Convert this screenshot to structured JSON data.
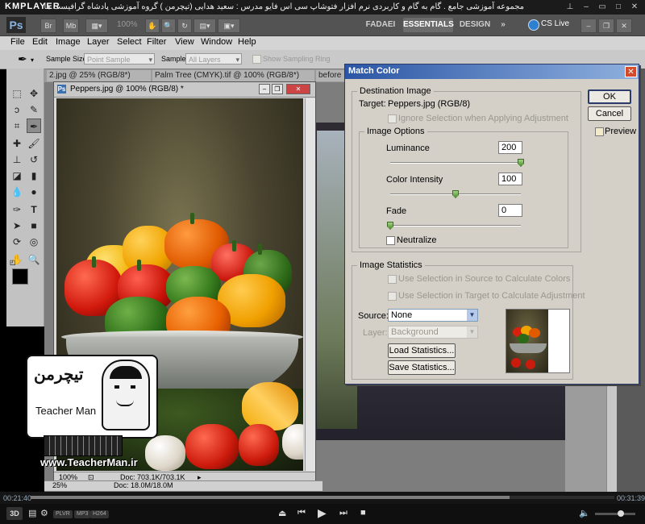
{
  "player": {
    "logo": "KMPLAYER",
    "title": "مجموعه آموزشی جامع . گام به گام و کاربردی نرم افزار فتوشاپ سی اس فایو  مدرس : سعید هدایی (تیچرمن ) گروه آموزشی پادشاه گرافیست ها",
    "time_elapsed": "00:21:40",
    "time_total": "00:31:39",
    "progress": 0.82,
    "badges": [
      "PLVR",
      "MP3",
      "H264"
    ],
    "mode_label": "3D"
  },
  "photoshop": {
    "logo": "Ps",
    "zoom": "100%",
    "workspaces": [
      "FADAEI",
      "ESSENTIALS",
      "DESIGN"
    ],
    "active_workspace": "ESSENTIALS",
    "cs_live": "CS Live",
    "menu": [
      "File",
      "Edit",
      "Image",
      "Layer",
      "Select",
      "Filter",
      "View",
      "Window",
      "Help"
    ],
    "options": {
      "sample_size_label": "Sample Size:",
      "sample_size_value": "Point Sample",
      "sample_label": "Sample:",
      "sample_value": "All Layers",
      "show_ring": "Show Sampling Ring"
    },
    "tabs": [
      "2.jpg @ 25% (RGB/8*)",
      "Palm Tree (CMYK).tif @ 100% (RGB/8*)",
      "before"
    ],
    "document": {
      "title": "Peppers.jpg @ 100% (RGB/8) *",
      "zoom": "100%",
      "doc_size": "Doc: 703.1K/703.1K"
    },
    "document2": {
      "zoom": "25%",
      "doc_size": "Doc: 18.0M/18.0M"
    }
  },
  "dialog": {
    "title": "Match Color",
    "ok": "OK",
    "cancel": "Cancel",
    "preview": "Preview",
    "destination_label": "Destination Image",
    "target_label": "Target:",
    "target_value": "Peppers.jpg (RGB/8)",
    "ignore_selection": "Ignore Selection when Applying Adjustment",
    "image_options_label": "Image Options",
    "luminance_label": "Luminance",
    "luminance_value": "200",
    "luminance_fraction": 1.0,
    "intensity_label": "Color Intensity",
    "intensity_value": "100",
    "intensity_fraction": 0.5,
    "fade_label": "Fade",
    "fade_value": "0",
    "fade_fraction": 0.0,
    "neutralize": "Neutralize",
    "stats_label": "Image Statistics",
    "use_sel_source": "Use Selection in Source to Calculate Colors",
    "use_sel_target": "Use Selection in Target to Calculate Adjustment",
    "source_label": "Source:",
    "source_value": "None",
    "layer_label": "Layer:",
    "layer_value": "Background",
    "load_stats": "Load Statistics...",
    "save_stats": "Save Statistics..."
  },
  "watermark": {
    "url": "www.TeacherMan.ir",
    "name": "Teacher Man",
    "persian": "تیچرمن"
  }
}
